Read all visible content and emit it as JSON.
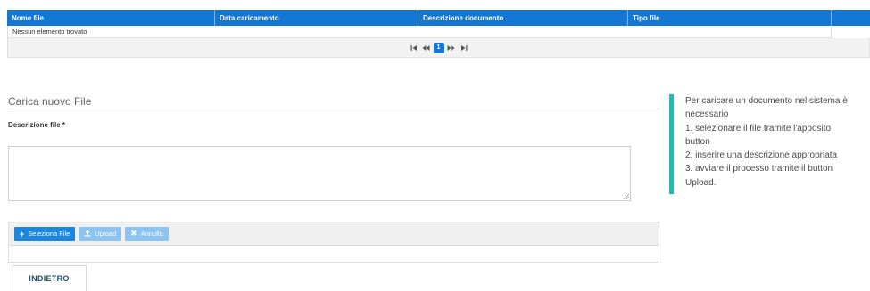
{
  "table": {
    "columns": [
      "Nome file",
      "Data caricamento",
      "Descrizione documento",
      "Tipo file",
      ""
    ],
    "empty_message": "Nessun elemento trovato",
    "pager": {
      "first": "⏮",
      "prev": "◀◀",
      "current_page": "1",
      "next": "▶▶",
      "last": "⏭"
    }
  },
  "form": {
    "section_title": "Carica nuovo File",
    "description_label": "Descrizione file *",
    "description_value": ""
  },
  "upload": {
    "select_label": "Seleziona File",
    "upload_label": "Upload",
    "cancel_label": "Annulla"
  },
  "back_button": "INDIETRO",
  "info": {
    "lines": [
      "Per caricare un documento nel sistema è",
      "necessario",
      "1. selezionare il file tramite l'apposito",
      "button",
      "2. inserire una descrizione appropriata",
      "3. avviare il processo tramite il button",
      "Upload."
    ]
  },
  "colors": {
    "header_blue": "#1477d4",
    "accent_teal": "#25b9b3",
    "button_blue": "#1a86e0",
    "button_disabled": "#8cc3ef"
  }
}
